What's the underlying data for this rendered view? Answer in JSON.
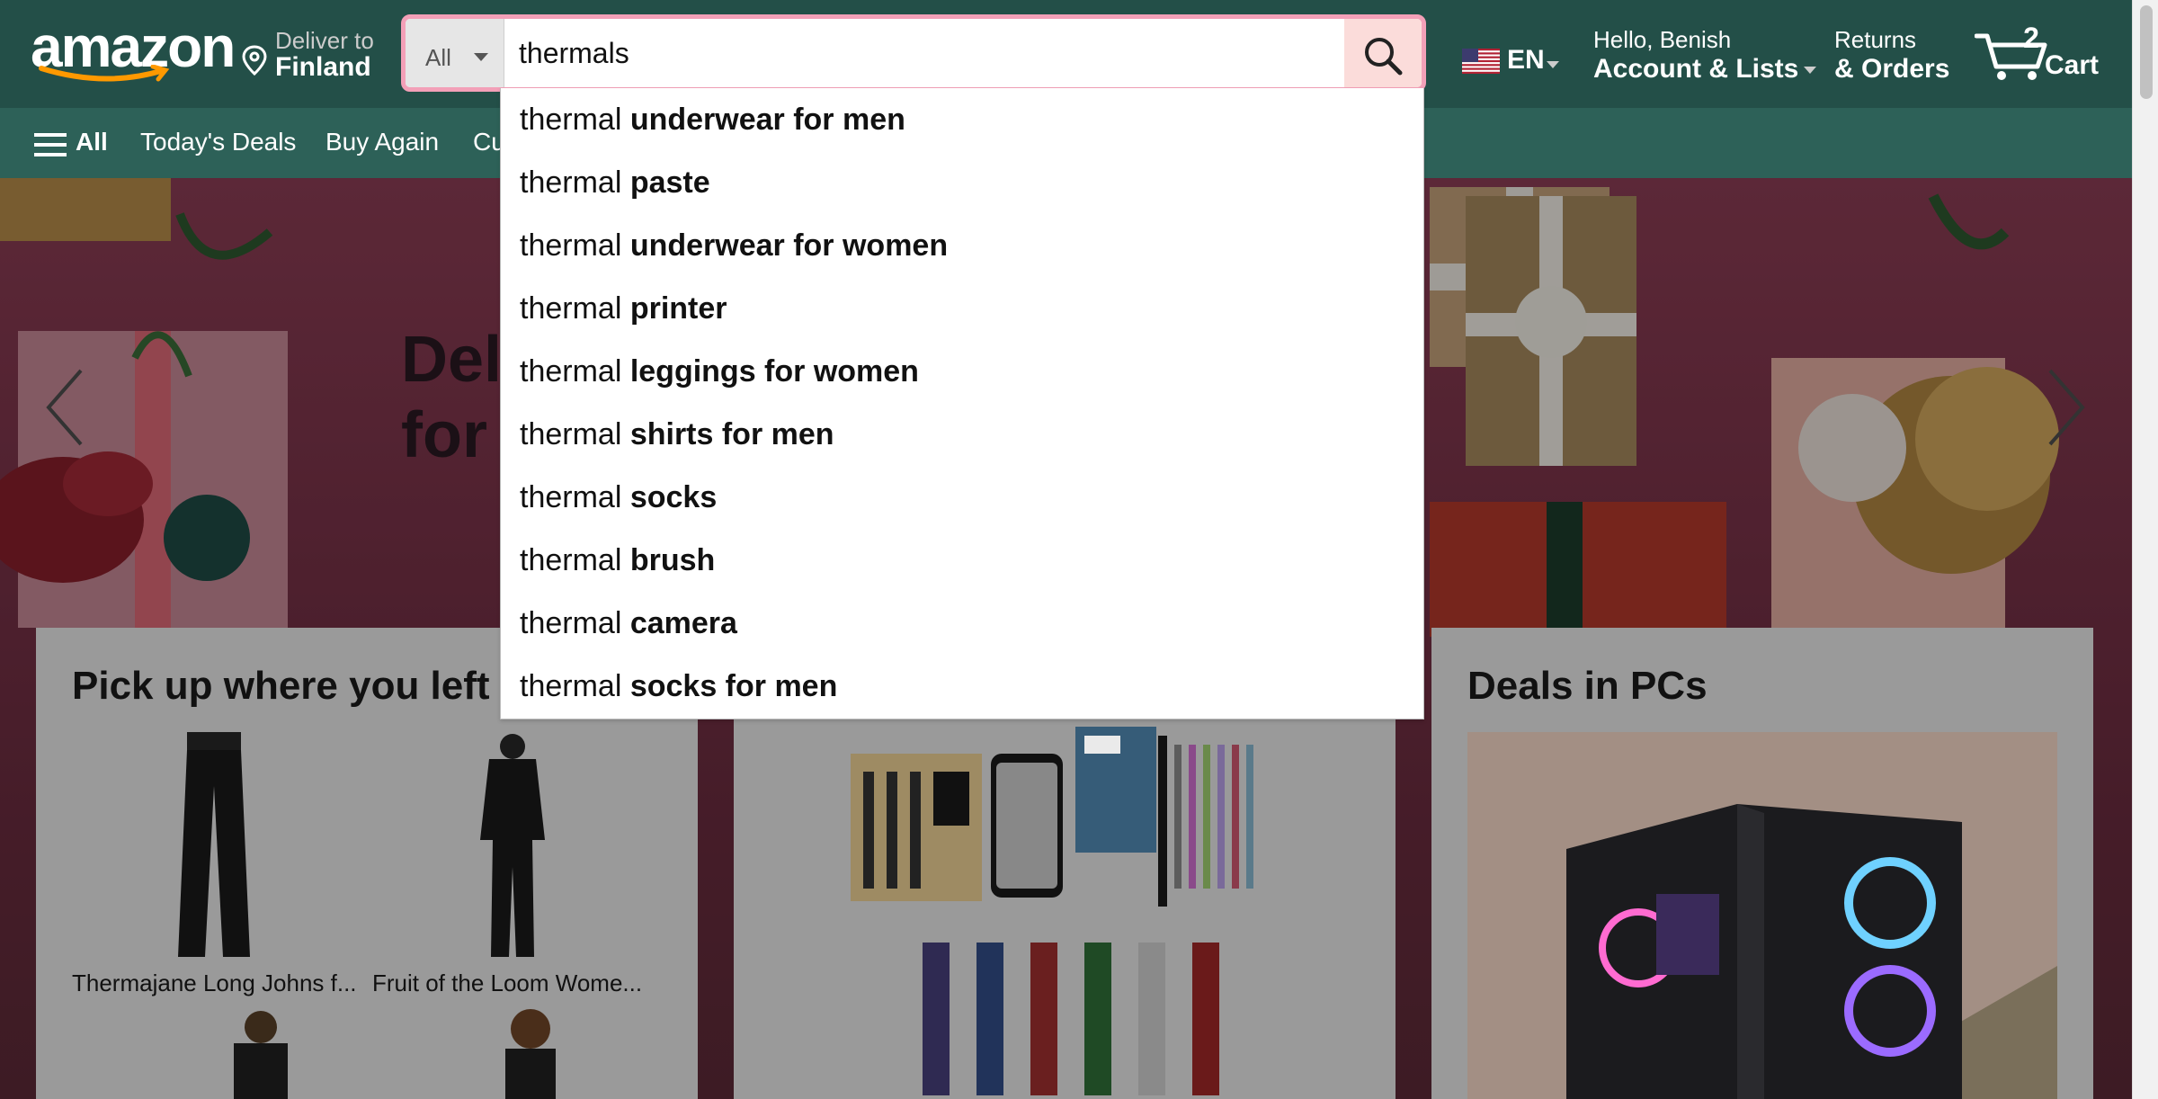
{
  "header": {
    "logo_text": "amazon",
    "deliver_label": "Deliver to",
    "deliver_location": "Finland",
    "search": {
      "category": "All",
      "query": "thermals"
    },
    "language": "EN",
    "account_greeting": "Hello, Benish",
    "account_label": "Account & Lists",
    "returns_label": "Returns",
    "orders_label": "& Orders",
    "cart_count": "2",
    "cart_label": "Cart"
  },
  "subnav": {
    "all_label": "All",
    "items": [
      "Today's Deals",
      "Buy Again",
      "Cu"
    ]
  },
  "hero": {
    "title_line1": "Del",
    "title_line2": "for"
  },
  "suggestions": [
    {
      "prefix": "thermal ",
      "bold": "underwear for men"
    },
    {
      "prefix": "thermal ",
      "bold": "paste"
    },
    {
      "prefix": "thermal ",
      "bold": "underwear for women"
    },
    {
      "prefix": "thermal ",
      "bold": "printer"
    },
    {
      "prefix": "thermal ",
      "bold": "leggings for women"
    },
    {
      "prefix": "thermal ",
      "bold": "shirts for men"
    },
    {
      "prefix": "thermal ",
      "bold": "socks"
    },
    {
      "prefix": "thermal ",
      "bold": "brush"
    },
    {
      "prefix": "thermal ",
      "bold": "camera"
    },
    {
      "prefix": "thermal ",
      "bold": "socks for men"
    }
  ],
  "cards": {
    "card1": {
      "title": "Pick up where you left o",
      "products": [
        "Thermajane Long Johns f...",
        "Fruit of the Loom Wome..."
      ]
    },
    "card3": {
      "title": "Deals in PCs"
    }
  },
  "colors": {
    "nav_top": "#234f48",
    "nav_sub": "#2d6158",
    "search_border": "#f3a0b8",
    "search_button": "#fbdcda"
  },
  "icons": [
    "location-pin-icon",
    "search-icon",
    "us-flag-icon",
    "cart-icon",
    "hamburger-icon",
    "chevron-left-icon",
    "chevron-right-icon"
  ]
}
